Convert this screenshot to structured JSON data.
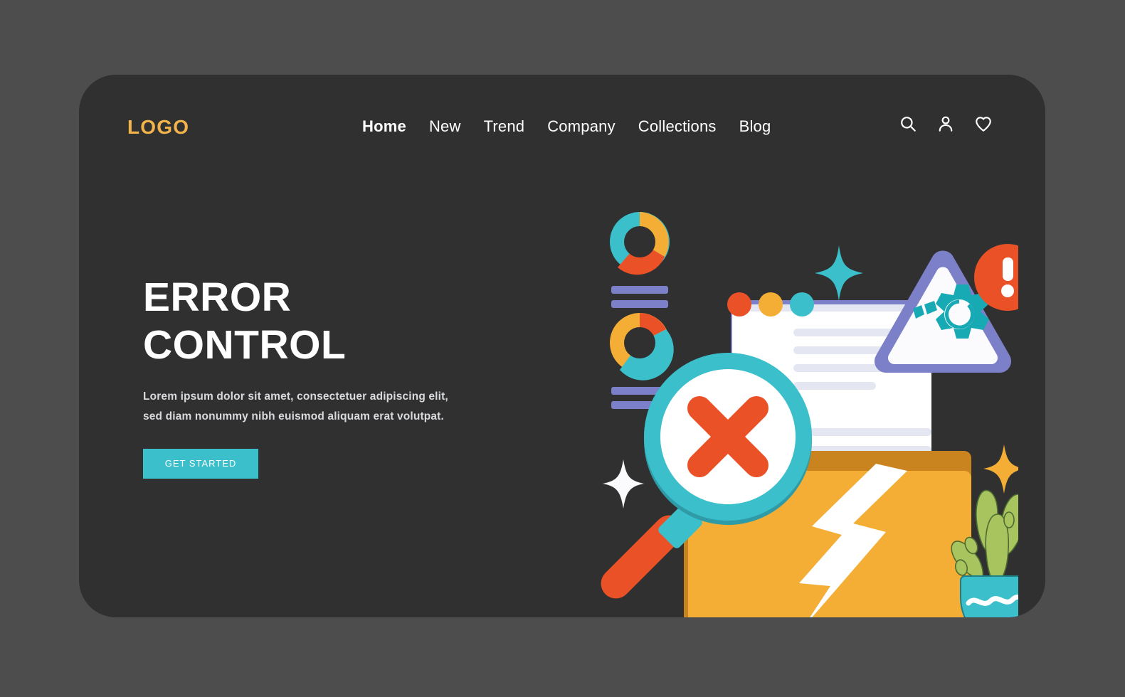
{
  "theme": {
    "page_background": "#4d4d4d",
    "card_background": "#303030",
    "logo_color": "#F2B34B",
    "accent_teal": "#3BBFCB",
    "accent_orange": "#EA5126",
    "accent_yellow": "#F4AE35",
    "accent_purple": "#7C80C8",
    "text_white": "#FFFFFF",
    "text_muted": "#D9DADE"
  },
  "header": {
    "logo": "LOGO",
    "nav": [
      {
        "label": "Home",
        "active": true
      },
      {
        "label": "New",
        "active": false
      },
      {
        "label": "Trend",
        "active": false
      },
      {
        "label": "Company",
        "active": false
      },
      {
        "label": "Collections",
        "active": false
      },
      {
        "label": "Blog",
        "active": false
      }
    ],
    "icons": [
      {
        "name": "search-icon"
      },
      {
        "name": "user-icon"
      },
      {
        "name": "heart-icon"
      }
    ]
  },
  "hero": {
    "title": "ERROR\nCONTROL",
    "subtitle": "Lorem ipsum dolor sit amet, consectetuer adipiscing elit, sed diam nonummy nibh euismod aliquam erat volutpat.",
    "cta_label": "GET STARTED"
  },
  "illustration": {
    "name": "error-control-illustration",
    "elements": [
      "donut-chart-top",
      "donut-chart-bottom",
      "placeholder-bars",
      "document-page",
      "document-dots",
      "warning-triangle",
      "broken-gear-icon",
      "exclamation-badge",
      "magnifier-with-x",
      "folder-with-lightning",
      "potted-plant",
      "sparkles"
    ],
    "donut_top": {
      "segments": [
        {
          "color": "#F4AE35",
          "portion": 0.2
        },
        {
          "color": "#EA5126",
          "portion": 0.33
        },
        {
          "color": "#3BBFCB",
          "portion": 0.47
        }
      ]
    },
    "donut_bottom": {
      "segments": [
        {
          "color": "#EA5126",
          "portion": 0.15
        },
        {
          "color": "#3BBFCB",
          "portion": 0.33
        },
        {
          "color": "#F4AE35",
          "portion": 0.52
        }
      ]
    },
    "document_dots": [
      "#EA5126",
      "#F4AE35",
      "#3BBFCB"
    ],
    "sparkle_colors": [
      "#3BBFCB",
      "#FFFFFF",
      "#F4AE35"
    ]
  }
}
